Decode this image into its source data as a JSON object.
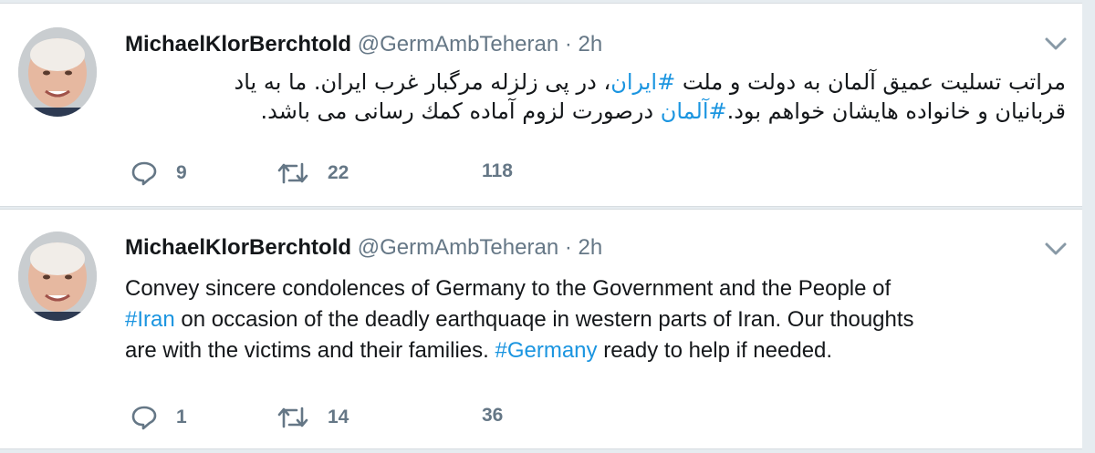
{
  "colors": {
    "link": "#1b95e0",
    "muted": "#657786",
    "text": "#14171a",
    "background": "#e6ecf0"
  },
  "tweets": [
    {
      "author_name": "MichaelKlorBerchtold",
      "handle": "@GermAmbTeheran",
      "separator": "·",
      "time": "2h",
      "text_lines": [
        {
          "before": "مراتب تسلیت عمیق آلمان به دولت و ملت ",
          "hashtag": "#ایران",
          "after": "، در پی زلزله مرگبار غرب ایران. ما به یاد"
        },
        {
          "before": "قربانیان و خانواده هایشان خواهم بود.",
          "hashtag": "#آلمان",
          "after": " درصورت لزوم آماده کمك رسانی می باشد."
        }
      ],
      "replies": "9",
      "retweets": "22",
      "likes": "118"
    },
    {
      "author_name": "MichaelKlorBerchtold",
      "handle": "@GermAmbTeheran",
      "separator": "·",
      "time": "2h",
      "text_lines": [
        {
          "before": "Convey sincere condolences of Germany to the Government and the People of",
          "hashtag": "",
          "after": ""
        },
        {
          "before": "",
          "hashtag": "#Iran",
          "after": " on occasion of the deadly earthquaqe in western parts of Iran. Our thoughts"
        },
        {
          "before": "are with the victims and their families. ",
          "hashtag": "#Germany",
          "after": " ready to help if needed."
        }
      ],
      "replies": "1",
      "retweets": "14",
      "likes": "36"
    }
  ],
  "icons": {
    "reply": "speech-bubble-icon",
    "retweet": "retweet-arrows-icon",
    "caret": "chevron-down-icon",
    "avatar": "profile-photo"
  }
}
